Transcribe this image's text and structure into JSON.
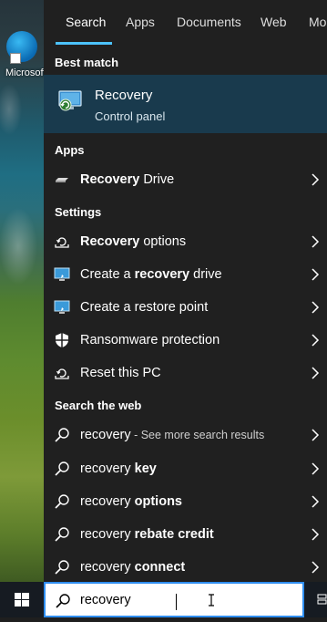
{
  "desktop": {
    "icon_label": "Microsoft Edge"
  },
  "tabs": [
    "Search",
    "Apps",
    "Documents",
    "Web",
    "More"
  ],
  "sections": {
    "best_match": "Best match",
    "apps": "Apps",
    "settings": "Settings",
    "search_web": "Search the web"
  },
  "best_match": {
    "title": "Recovery",
    "subtitle": "Control panel",
    "icon": "recovery-control-panel-icon"
  },
  "apps": [
    {
      "bold": "Recovery",
      "rest": " Drive",
      "icon": "drive-icon"
    }
  ],
  "settings": [
    {
      "pre": "",
      "bold": "Recovery",
      "post": " options",
      "icon": "recovery-settings-icon"
    },
    {
      "pre": "Create a ",
      "bold": "recovery",
      "post": " drive",
      "icon": "monitor-icon"
    },
    {
      "pre": "Create a restore point",
      "bold": "",
      "post": "",
      "icon": "monitor-icon"
    },
    {
      "pre": "Ransomware protection",
      "bold": "",
      "post": "",
      "icon": "shield-icon"
    },
    {
      "pre": "Reset this PC",
      "bold": "",
      "post": "",
      "icon": "reset-icon"
    }
  ],
  "web": [
    {
      "base": "recovery",
      "bold": "",
      "muted": " - See more search results"
    },
    {
      "base": "recovery ",
      "bold": "key",
      "muted": ""
    },
    {
      "base": "recovery ",
      "bold": "options",
      "muted": ""
    },
    {
      "base": "recovery ",
      "bold": "rebate credit",
      "muted": ""
    },
    {
      "base": "recovery ",
      "bold": "connect",
      "muted": ""
    }
  ],
  "search": {
    "value": "recovery"
  },
  "colors": {
    "panel": "#202020",
    "selected": "#193a4d",
    "accent": "#4cc2ff",
    "taskbar": "#161b22"
  }
}
